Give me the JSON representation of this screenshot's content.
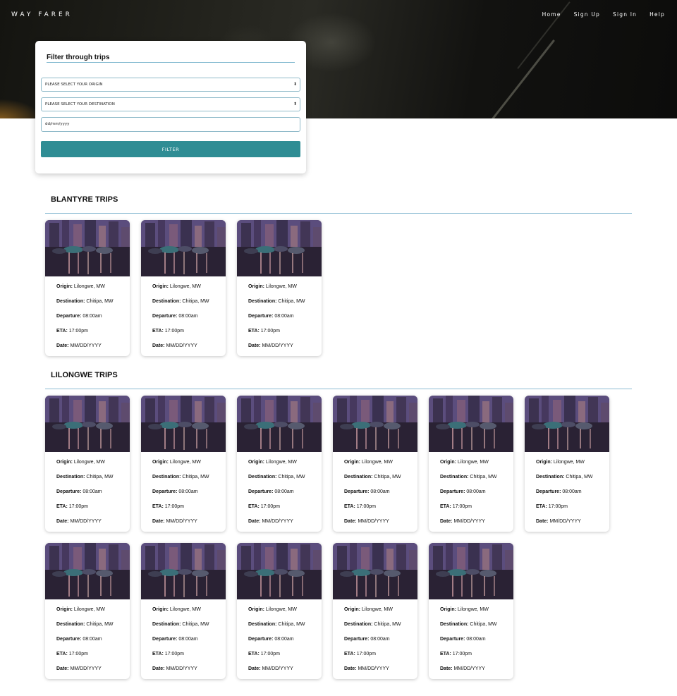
{
  "brand": "WAY FARER",
  "nav": [
    "Home",
    "Sign Up",
    "Sign In",
    "Help"
  ],
  "filter": {
    "title": "Filter through trips",
    "origin_placeholder": "PLEASE SELECT YOUR ORIGIN",
    "destination_placeholder": "PLEASE SELECT YOUR DESTINATION",
    "date_placeholder": "dd/mm/yyyy",
    "button": "FILTER"
  },
  "labels": {
    "origin": "Origin:",
    "destination": "Destination:",
    "departure": "Departure:",
    "eta": "ETA:",
    "date": "Date:"
  },
  "sections": [
    {
      "title": "BLANTYRE TRIPS",
      "trips": [
        {
          "origin": "Lilongwe, MW",
          "destination": "Chitipa, MW",
          "departure": "08:00am",
          "eta": "17:00pm",
          "date": "MM/DD/YYYY"
        },
        {
          "origin": "Lilongwe, MW",
          "destination": "Chitipa, MW",
          "departure": "08:00am",
          "eta": "17:00pm",
          "date": "MM/DD/YYYY"
        },
        {
          "origin": "Lilongwe, MW",
          "destination": "Chitipa, MW",
          "departure": "08:00am",
          "eta": "17:00pm",
          "date": "MM/DD/YYYY"
        }
      ]
    },
    {
      "title": "LILONGWE TRIPS",
      "trips": [
        {
          "origin": "Lilongwe, MW",
          "destination": "Chitipa, MW",
          "departure": "08:00am",
          "eta": "17:00pm",
          "date": "MM/DD/YYYY"
        },
        {
          "origin": "Lilongwe, MW",
          "destination": "Chitipa, MW",
          "departure": "08:00am",
          "eta": "17:00pm",
          "date": "MM/DD/YYYY"
        },
        {
          "origin": "Lilongwe, MW",
          "destination": "Chitipa, MW",
          "departure": "08:00am",
          "eta": "17:00pm",
          "date": "MM/DD/YYYY"
        },
        {
          "origin": "Lilongwe, MW",
          "destination": "Chitipa, MW",
          "departure": "08:00am",
          "eta": "17:00pm",
          "date": "MM/DD/YYYY"
        },
        {
          "origin": "Lilongwe, MW",
          "destination": "Chitipa, MW",
          "departure": "08:00am",
          "eta": "17:00pm",
          "date": "MM/DD/YYYY"
        },
        {
          "origin": "Lilongwe, MW",
          "destination": "Chitipa, MW",
          "departure": "08:00am",
          "eta": "17:00pm",
          "date": "MM/DD/YYYY"
        },
        {
          "origin": "Lilongwe, MW",
          "destination": "Chitipa, MW",
          "departure": "08:00am",
          "eta": "17:00pm",
          "date": "MM/DD/YYYY"
        },
        {
          "origin": "Lilongwe, MW",
          "destination": "Chitipa, MW",
          "departure": "08:00am",
          "eta": "17:00pm",
          "date": "MM/DD/YYYY"
        },
        {
          "origin": "Lilongwe, MW",
          "destination": "Chitipa, MW",
          "departure": "08:00am",
          "eta": "17:00pm",
          "date": "MM/DD/YYYY"
        },
        {
          "origin": "Lilongwe, MW",
          "destination": "Chitipa, MW",
          "departure": "08:00am",
          "eta": "17:00pm",
          "date": "MM/DD/YYYY"
        },
        {
          "origin": "Lilongwe, MW",
          "destination": "Chitipa, MW",
          "departure": "08:00am",
          "eta": "17:00pm",
          "date": "MM/DD/YYYY"
        }
      ]
    }
  ],
  "colors": {
    "accent": "#2f8d94",
    "rule": "#8dbdd3"
  }
}
